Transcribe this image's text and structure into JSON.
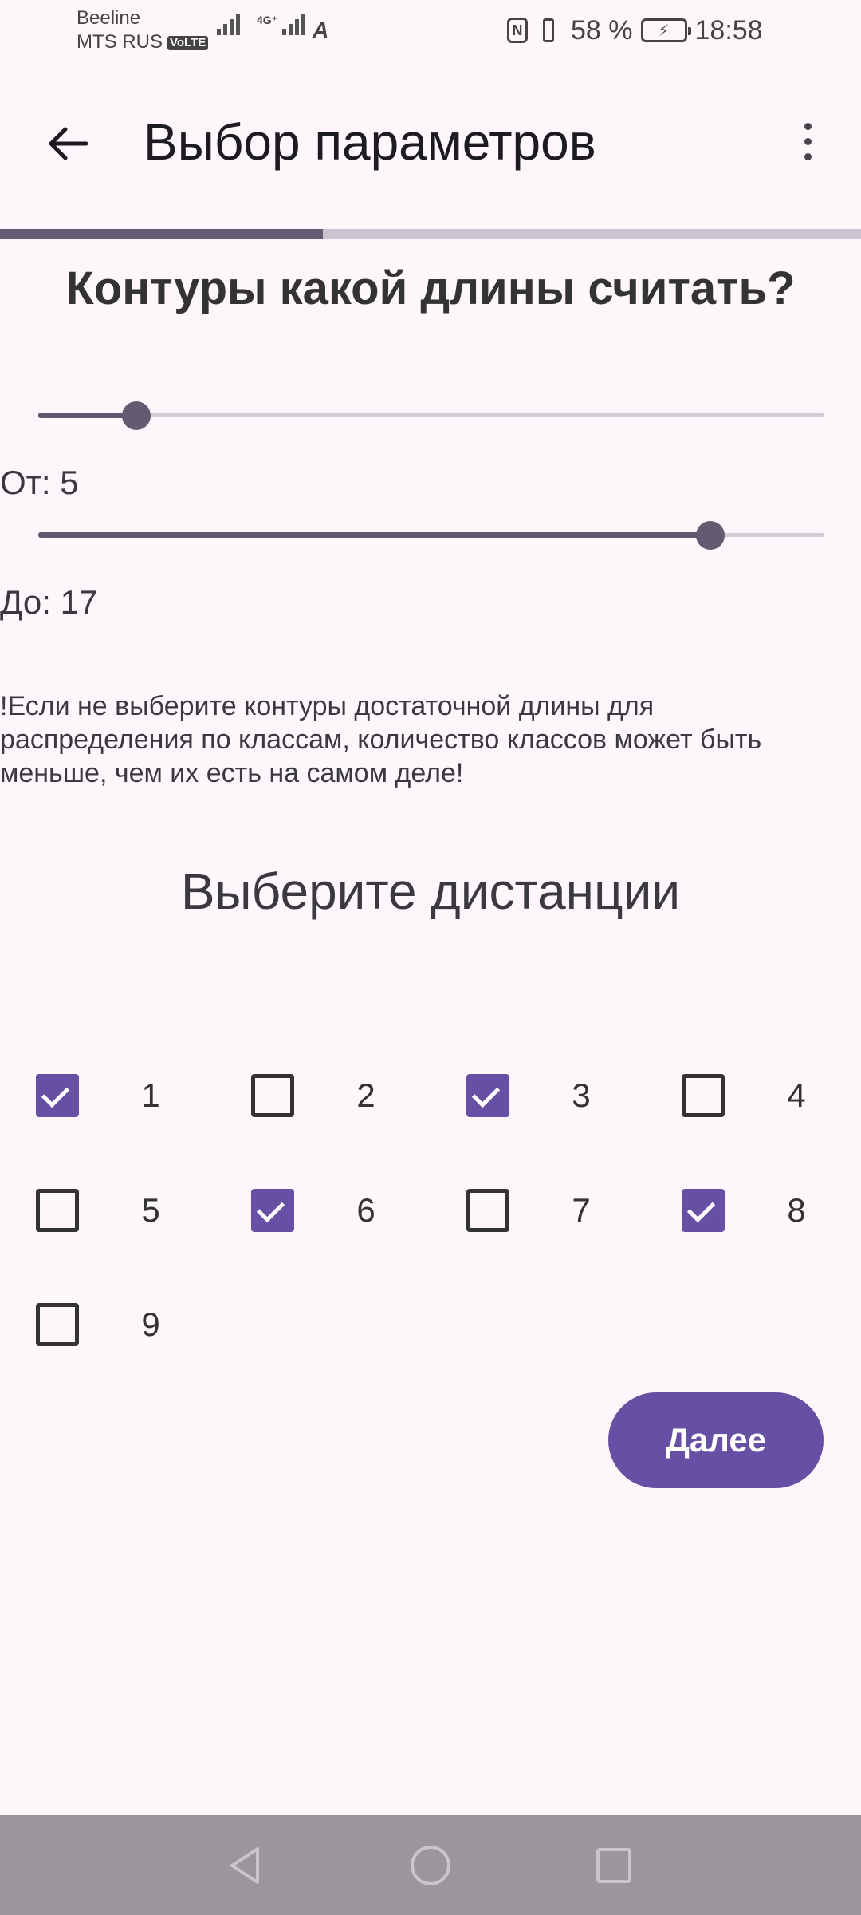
{
  "status_bar": {
    "carrier_1": "Beeline",
    "carrier_2": "MTS RUS",
    "volte": "VoLTE",
    "network": "4G⁺",
    "nfc": "N",
    "battery_percent": "58 %",
    "time": "18:58",
    "icons": [
      "signal-icon",
      "signal-4g-icon",
      "data-saver-icon",
      "nfc-icon",
      "vibrate-icon",
      "battery-charging-icon"
    ]
  },
  "app_bar": {
    "title": "Выбор параметров",
    "back_icon": "arrow-back-icon",
    "menu_icon": "more-vert-icon"
  },
  "progress": {
    "value_percent": 37.5,
    "colors": {
      "fill": "#625b71",
      "track": "#cac4d0"
    }
  },
  "question": "Контуры какой длины считать?",
  "sliders": {
    "from": {
      "label": "От: 5",
      "value_fraction": 0.125
    },
    "to": {
      "label": "До: 17",
      "value_fraction": 0.855
    }
  },
  "warning": "!Если не выберите контуры достаточной длины для распределения по классам, количество классов может быть меньше, чем их есть на самом деле!",
  "distances": {
    "title": "Выберите дистанции",
    "items": [
      {
        "label": "1",
        "checked": true
      },
      {
        "label": "2",
        "checked": false
      },
      {
        "label": "3",
        "checked": true
      },
      {
        "label": "4",
        "checked": false
      },
      {
        "label": "5",
        "checked": false
      },
      {
        "label": "6",
        "checked": true
      },
      {
        "label": "7",
        "checked": false
      },
      {
        "label": "8",
        "checked": true
      },
      {
        "label": "9",
        "checked": false
      }
    ]
  },
  "next_button": {
    "label": "Далее"
  },
  "colors": {
    "accent": "#6750a4",
    "background": "#fdf7fc",
    "navbar": "#9a969b"
  }
}
